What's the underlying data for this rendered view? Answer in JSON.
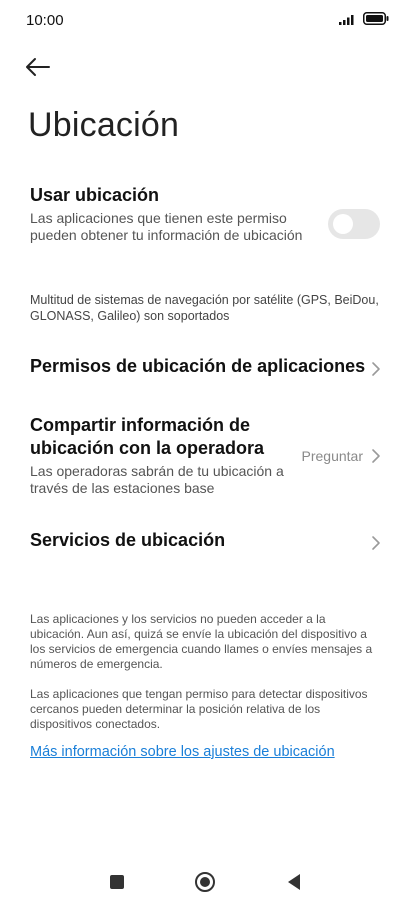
{
  "status_bar": {
    "time": "10:00",
    "icons": [
      "signal-icon",
      "battery-icon"
    ]
  },
  "header": {
    "back_icon": "back-arrow-icon",
    "title": "Ubicación"
  },
  "use_location": {
    "title": "Usar ubicación",
    "description": "Las aplicaciones que tienen este permiso pueden obtener tu información de ubicación",
    "toggle_on": false
  },
  "gnss_note": "Multitud de sistemas de navegación por satélite (GPS, BeiDou, GLONASS, Galileo) son soportados",
  "app_permissions": {
    "title": "Permisos de ubicación de aplicaciones"
  },
  "operator_sharing": {
    "title": "Compartir información de ubicación con la operadora",
    "description": "Las operadoras sabrán de tu ubicación a través de las estaciones base",
    "value": "Preguntar"
  },
  "location_services": {
    "title": "Servicios de ubicación"
  },
  "footer": {
    "paragraph1": "Las aplicaciones y los servicios no pueden acceder a la ubicación. Aun así, quizá se envíe la ubicación del dispositivo a los servicios de emergencia cuando llames o envíes mensajes a números de emergencia.",
    "paragraph2": "Las aplicaciones que tengan permiso para detectar dispositivos cercanos pueden determinar la posición relativa de los dispositivos conectados.",
    "link": "Más información sobre los ajustes de ubicación"
  },
  "nav_bar": {
    "buttons": [
      "recents-square-icon",
      "home-circle-icon",
      "back-triangle-icon"
    ]
  },
  "colors": {
    "link": "#1a7fd8",
    "toggle_off": "#e6e6e6",
    "secondary_text": "#8a8a8a"
  }
}
